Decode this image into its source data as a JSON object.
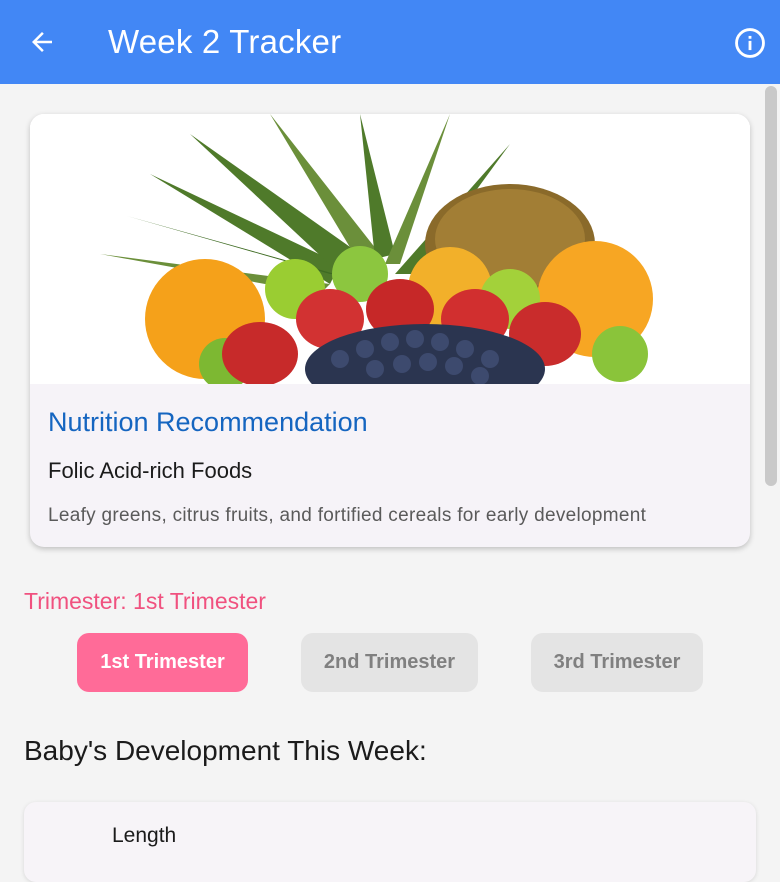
{
  "appbar": {
    "title": "Week 2 Tracker",
    "color": "#4287f5",
    "back_icon": "arrow-left-icon",
    "info_icon": "info-circle-icon"
  },
  "nutrition_card": {
    "image": "fruit-basket-photo",
    "heading": "Nutrition Recommendation",
    "subheading": "Folic Acid-rich Foods",
    "description": "Leafy greens, citrus fruits, and fortified cereals for early development"
  },
  "trimester": {
    "label": "Trimester: 1st Trimester",
    "options": [
      {
        "label": "1st Trimester",
        "selected": true
      },
      {
        "label": "2nd Trimester",
        "selected": false
      },
      {
        "label": "3rd Trimester",
        "selected": false
      }
    ],
    "active_color": "#ff6b98"
  },
  "development": {
    "heading": "Baby's Development This Week:",
    "items": [
      {
        "label": "Length"
      }
    ]
  }
}
